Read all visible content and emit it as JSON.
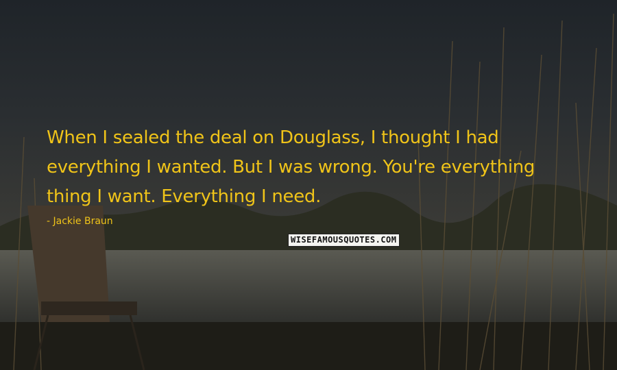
{
  "quote": {
    "lines": [
      "When I sealed the deal on Douglass, I thought I had",
      "everything I wanted. But I was wrong. You're everything",
      "thing I want. Everything I need."
    ],
    "author": "- Jackie Braun"
  },
  "watermark": "WISEFAMOUSQUOTES.COM",
  "colors": {
    "text": "#f0c419",
    "sky": "#23272c",
    "water": "#4a4a44"
  }
}
